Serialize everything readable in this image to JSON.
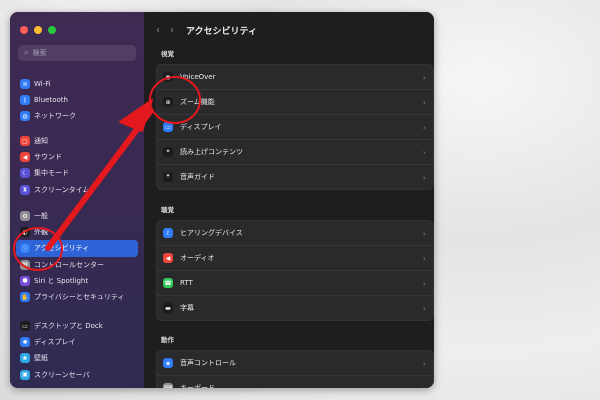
{
  "window": {
    "search": {
      "placeholder": "検索"
    }
  },
  "sidebar": {
    "group1": [
      {
        "label": "Wi-Fi",
        "icon": "wifi-icon",
        "color": "#2f7cf6",
        "glyph": "≋"
      },
      {
        "label": "Bluetooth",
        "icon": "bluetooth-icon",
        "color": "#2f7cf6",
        "glyph": "ᛒ"
      },
      {
        "label": "ネットワーク",
        "icon": "globe-icon",
        "color": "#2f7cf6",
        "glyph": "◍"
      }
    ],
    "group2": [
      {
        "label": "通知",
        "icon": "bell-icon",
        "color": "#f0453a",
        "glyph": "▢"
      },
      {
        "label": "サウンド",
        "icon": "speaker-icon",
        "color": "#f0453a",
        "glyph": "◀"
      },
      {
        "label": "集中モード",
        "icon": "moon-icon",
        "color": "#5b52d6",
        "glyph": "☾"
      },
      {
        "label": "スクリーンタイム",
        "icon": "hourglass-icon",
        "color": "#5b52d6",
        "glyph": "⧗"
      }
    ],
    "group3": [
      {
        "label": "一般",
        "icon": "gear-icon",
        "color": "#8e8e93",
        "glyph": "⚙"
      },
      {
        "label": "外観",
        "icon": "appearance-icon",
        "color": "#1c1c1e",
        "glyph": "◐"
      },
      {
        "label": "アクセシビリティ",
        "icon": "accessibility-icon",
        "color": "#2f7cf6",
        "glyph": "ⓘ"
      },
      {
        "label": "コントロールセンター",
        "icon": "control-center-icon",
        "color": "#8e8e93",
        "glyph": "▤"
      },
      {
        "label": "Siri と Spotlight",
        "icon": "siri-icon",
        "color": "#7a4ed9",
        "glyph": "●"
      },
      {
        "label": "プライバシーとセキュリティ",
        "icon": "hand-icon",
        "color": "#2f7cf6",
        "glyph": "✋"
      }
    ],
    "group4": [
      {
        "label": "デスクトップと Dock",
        "icon": "dock-icon",
        "color": "#1c1c1e",
        "glyph": "▭"
      },
      {
        "label": "ディスプレイ",
        "icon": "sun-icon",
        "color": "#2f7cf6",
        "glyph": "✺"
      },
      {
        "label": "壁紙",
        "icon": "wallpaper-icon",
        "color": "#2fa7e6",
        "glyph": "❀"
      },
      {
        "label": "スクリーンセーバ",
        "icon": "screensaver-icon",
        "color": "#2fa7e6",
        "glyph": "▣"
      }
    ]
  },
  "content": {
    "title": "アクセシビリティ",
    "back": "‹",
    "forward": "›",
    "sections": [
      {
        "title": "視覚",
        "rows": [
          {
            "label": "VoiceOver",
            "icon": "voiceover-icon",
            "color": "#1c1c1e",
            "glyph": "◉"
          },
          {
            "label": "ズーム機能",
            "icon": "zoom-icon",
            "color": "#1c1c1e",
            "glyph": "⊕"
          },
          {
            "label": "ディスプレイ",
            "icon": "display-icon",
            "color": "#2f7cf6",
            "glyph": "▭"
          },
          {
            "label": "読み上げコンテンツ",
            "icon": "speech-icon",
            "color": "#1c1c1e",
            "glyph": "❝"
          },
          {
            "label": "音声ガイド",
            "icon": "audio-description-icon",
            "color": "#1c1c1e",
            "glyph": "❞"
          }
        ]
      },
      {
        "title": "聴覚",
        "rows": [
          {
            "label": "ヒアリングデバイス",
            "icon": "ear-icon",
            "color": "#2f7cf6",
            "glyph": "ℰ"
          },
          {
            "label": "オーディオ",
            "icon": "audio-icon",
            "color": "#f0453a",
            "glyph": "◀"
          },
          {
            "label": "RTT",
            "icon": "rtt-icon",
            "color": "#34c759",
            "glyph": "☎"
          },
          {
            "label": "字幕",
            "icon": "captions-icon",
            "color": "#1c1c1e",
            "glyph": "▬"
          }
        ]
      },
      {
        "title": "動作",
        "rows": [
          {
            "label": "音声コントロール",
            "icon": "voice-control-icon",
            "color": "#2f7cf6",
            "glyph": "◈"
          },
          {
            "label": "キーボード",
            "icon": "keyboard-icon",
            "color": "#8e8e93",
            "glyph": "⌨"
          }
        ]
      }
    ]
  },
  "annotation": {
    "color": "#e3191e"
  }
}
